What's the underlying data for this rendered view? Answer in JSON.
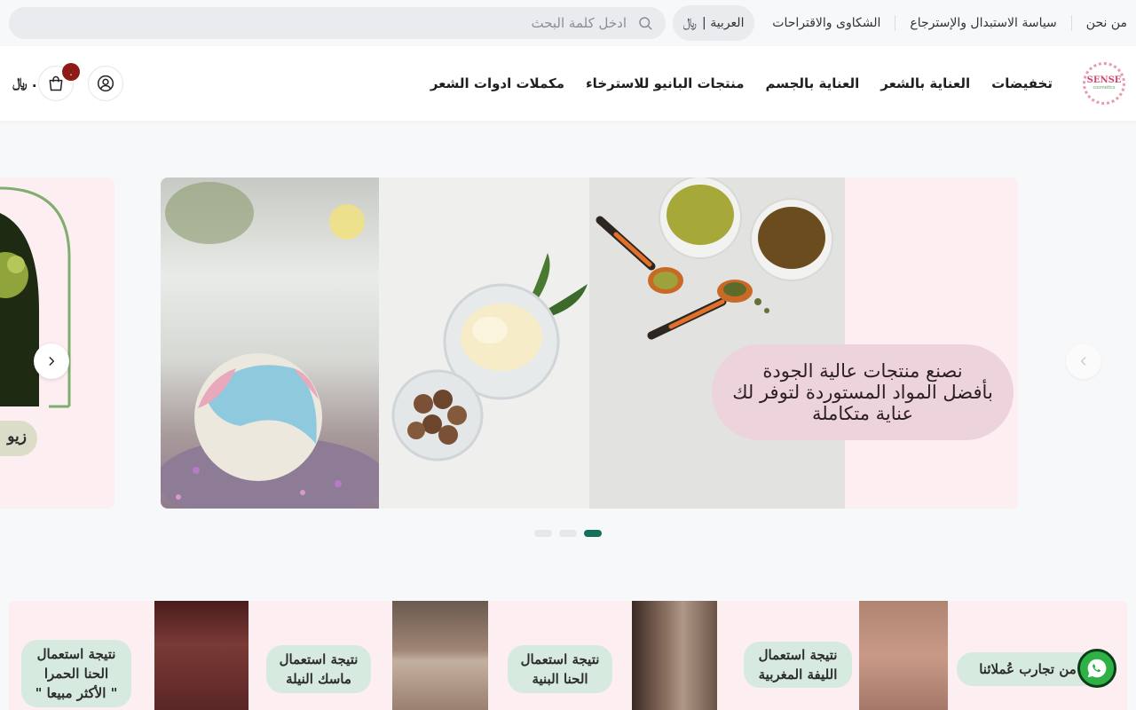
{
  "topbar": {
    "links": [
      "من نحن",
      "سياسة الاستبدال والإسترجاع",
      "الشكاوى والاقتراحات"
    ],
    "language_label": "العربية |",
    "currency_symbol": "﷼",
    "search_placeholder": "ادخل كلمة البحث"
  },
  "header": {
    "logo_text": "SENSE",
    "logo_sub": "cosmetics",
    "nav": [
      "تخفيضات",
      "العناية بالشعر",
      "العناية بالجسم",
      "منتجات البانيو للاسترخاء",
      "مكملات ادوات الشعر"
    ],
    "cart_count": ".",
    "cart_total": "﷼ ."
  },
  "hero": {
    "caption_lines": [
      "نصنع منتجات عالية الجودة",
      "بأفضل المواد المستوردة لتوفر لك",
      "عناية متكاملة"
    ],
    "peek_label": "زيو",
    "dots_count": 3,
    "active_dot": 2
  },
  "banner": {
    "pills": [
      {
        "lines": [
          "نتيجة استعمال",
          "الحنا الحمرا",
          "\" الأكثر مبيعا \""
        ]
      },
      {
        "lines": [
          "نتيجة استعمال",
          "ماسك النيلة"
        ]
      },
      {
        "lines": [
          "نتيجة استعمال",
          "الحنا البنية"
        ]
      },
      {
        "lines": [
          "نتيجة استعمال",
          "الليفة المغربية"
        ]
      },
      {
        "lines": [
          "من تجارب عُملائنا"
        ]
      }
    ]
  },
  "colors": {
    "accent": "#15705a",
    "badge": "#8e1b16",
    "pink_bg": "#fdeef2",
    "pill_green": "#d7eadf",
    "whatsapp": "#2fb146"
  },
  "icons": [
    "search-icon",
    "riyal-icon",
    "user-icon",
    "bag-icon",
    "chevron-left-icon",
    "chevron-right-icon",
    "whatsapp-icon"
  ]
}
